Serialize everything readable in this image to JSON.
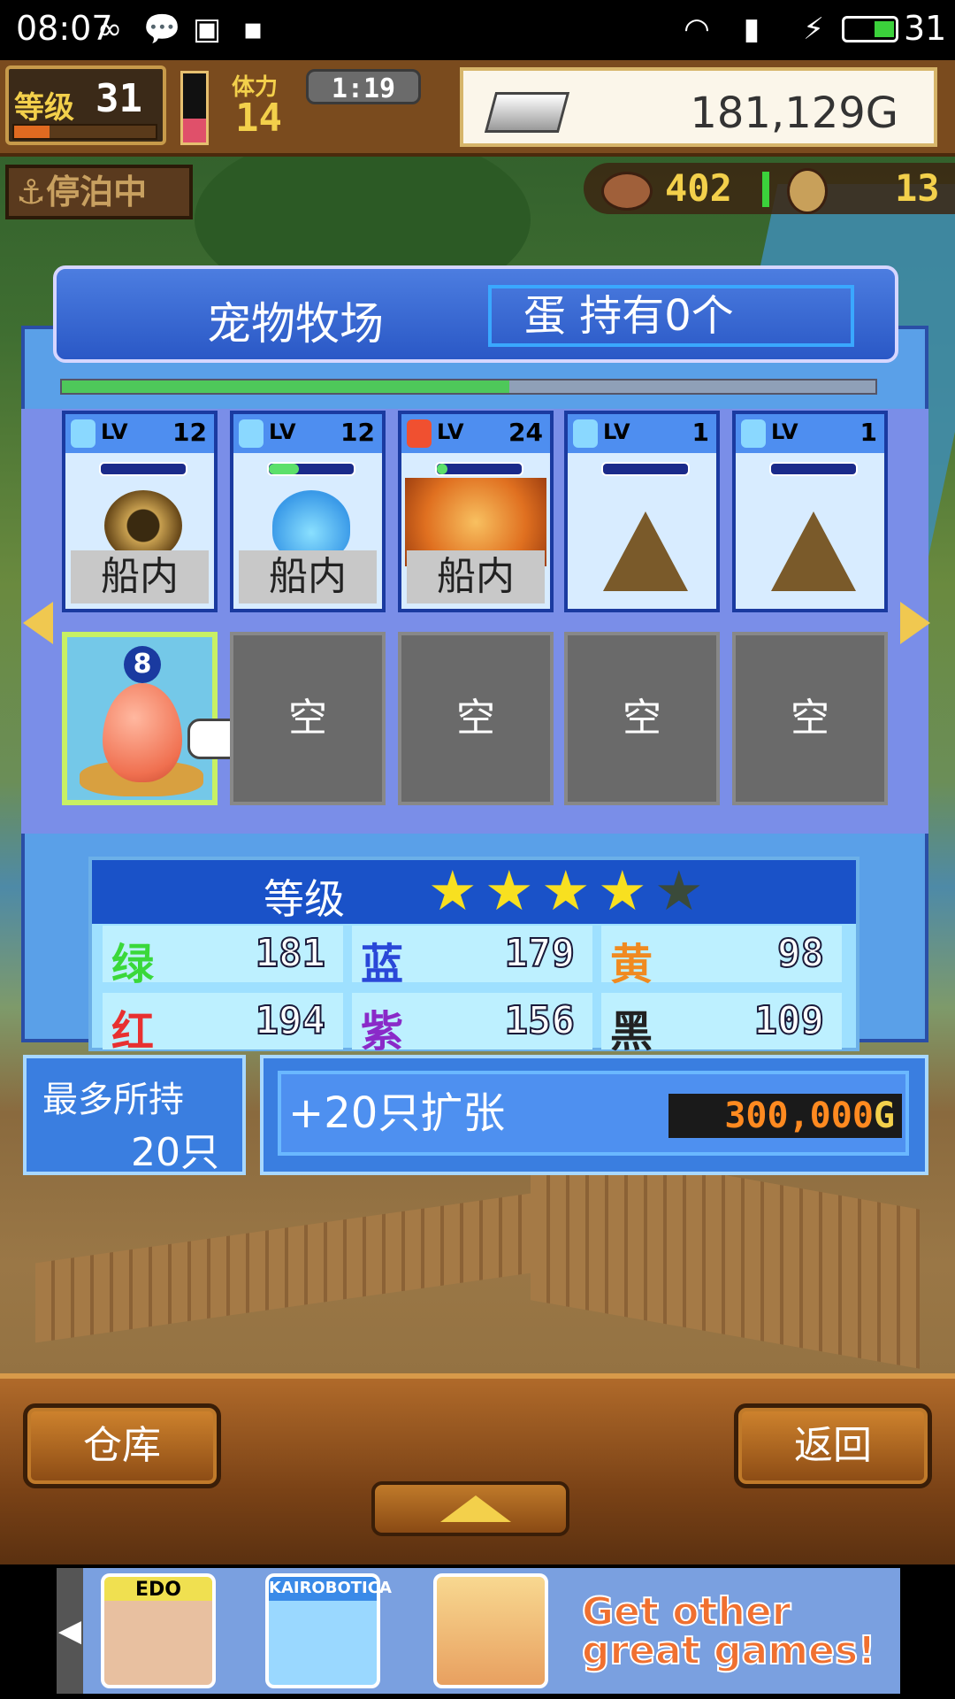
{
  "status_bar": {
    "time": "08:07",
    "battery_level": "31",
    "icons": [
      "infinity-icon",
      "chat-icon",
      "image-icon",
      "sd-icon",
      "wifi-icon",
      "signal-4g-icon",
      "charging-icon",
      "battery-icon"
    ]
  },
  "hud": {
    "level_label": "等级",
    "level_value": "31",
    "stamina_label": "体力",
    "stamina_value": "14",
    "timer": "1:19",
    "money": "181,129G",
    "docked_label": "停泊中",
    "food_count": "402",
    "coin_count": "13"
  },
  "dialog": {
    "title": "宠物牧场",
    "egg_status": "蛋 持有0个",
    "progress": 0.55
  },
  "pets": [
    {
      "element": "water",
      "lv_label": "LV",
      "level": "12",
      "hp": 0.0,
      "location": "船内"
    },
    {
      "element": "water",
      "lv_label": "LV",
      "level": "12",
      "hp": 0.35,
      "location": "船内"
    },
    {
      "element": "fire",
      "lv_label": "LV",
      "level": "24",
      "hp": 0.12,
      "location": "船内"
    },
    {
      "element": "water",
      "lv_label": "LV",
      "level": "1",
      "hp": 0.0,
      "location": ""
    },
    {
      "element": "water",
      "lv_label": "LV",
      "level": "1",
      "hp": 0.0,
      "location": ""
    }
  ],
  "eggs": {
    "selected_number": "8",
    "empty_label": "空",
    "slots": [
      "空",
      "空",
      "空",
      "空"
    ]
  },
  "stats": {
    "grade_label": "等级",
    "stars_total": 5,
    "stars_filled": 4,
    "rows": [
      [
        {
          "key": "绿",
          "value": "181",
          "color": "#3ad83a"
        },
        {
          "key": "蓝",
          "value": "179",
          "color": "#2a48d8"
        },
        {
          "key": "黄",
          "value": "98",
          "color": "#f08a20"
        }
      ],
      [
        {
          "key": "红",
          "value": "194",
          "color": "#e83030"
        },
        {
          "key": "紫",
          "value": "156",
          "color": "#8a2ac8"
        },
        {
          "key": "黑",
          "value": "109",
          "color": "#222222"
        }
      ]
    ]
  },
  "capacity": {
    "label": "最多所持",
    "value": "20只"
  },
  "expand": {
    "label": "+20只扩张",
    "price": "300,000",
    "currency": "G"
  },
  "buttons": {
    "warehouse": "仓库",
    "back": "返回"
  },
  "ad": {
    "games": [
      "EDO",
      "KAIROBOTICA",
      ""
    ],
    "text_line1": "Get other",
    "text_line2": "great games!"
  }
}
